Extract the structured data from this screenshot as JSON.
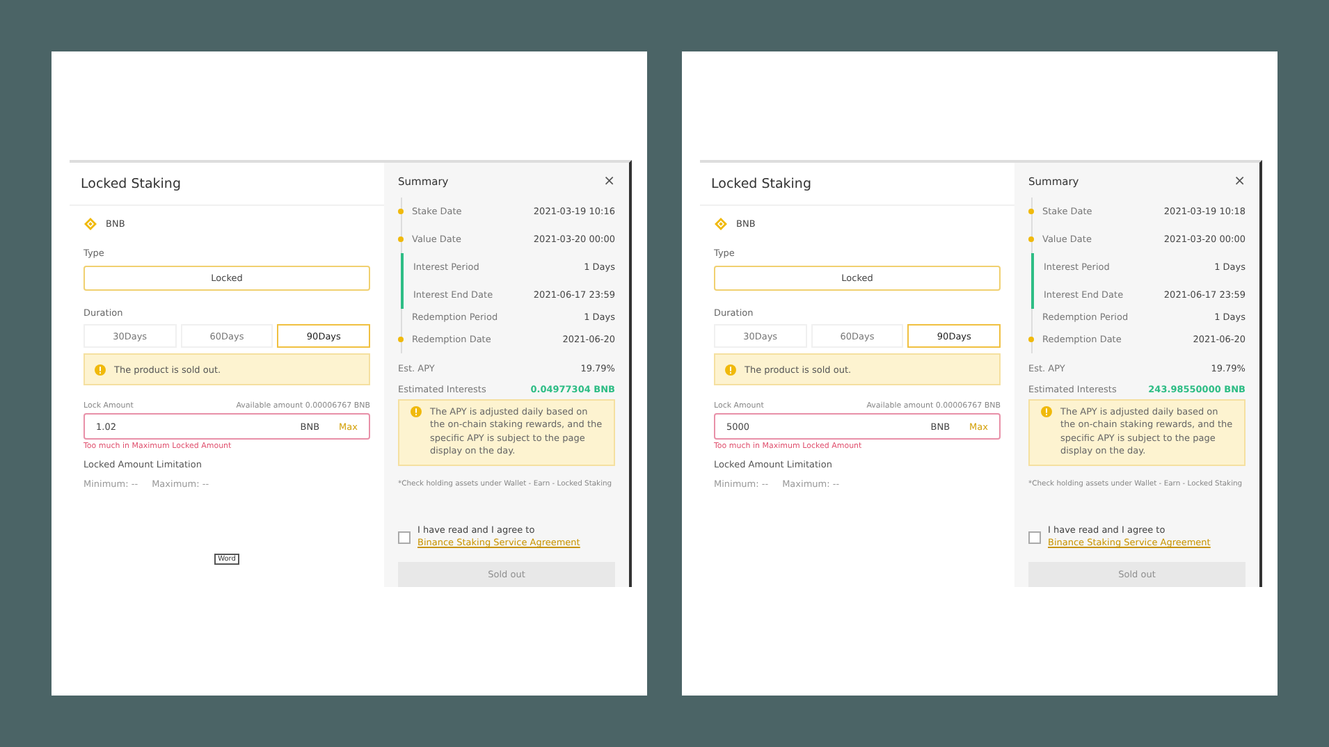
{
  "panels": [
    {
      "modal": {
        "title": "Locked Staking",
        "coin": "BNB",
        "type_label": "Type",
        "type_value": "Locked",
        "duration_label": "Duration",
        "durations": [
          {
            "label": "30Days",
            "selected": false
          },
          {
            "label": "60Days",
            "selected": false
          },
          {
            "label": "90Days",
            "selected": true
          }
        ],
        "alert": "The product is sold out.",
        "amount_label": "Lock Amount",
        "available": "Available amount 0.00006767 BNB",
        "amount_value": "1.02",
        "unit": "BNB",
        "max": "Max",
        "error": "Too much in Maximum Locked Amount",
        "limitation_title": "Locked Amount Limitation",
        "minimum": "Minimum: --",
        "maximum": "Maximum: --",
        "tooltip": "Word"
      },
      "summary": {
        "title": "Summary",
        "close": "×",
        "timeline": [
          {
            "label": "Stake Date",
            "value": "2021-03-19 10:16",
            "dot": true,
            "highlighted": false
          },
          {
            "label": "Value Date",
            "value": "2021-03-20 00:00",
            "dot": true,
            "highlighted": false
          },
          {
            "label": "Interest Period",
            "value": "1 Days",
            "dot": false,
            "highlighted": true
          },
          {
            "label": "Interest End Date",
            "value": "2021-06-17 23:59",
            "dot": false,
            "highlighted": true
          },
          {
            "label": "Redemption Period",
            "value": "1 Days",
            "dot": false,
            "highlighted": false
          },
          {
            "label": "Redemption Date",
            "value": "2021-06-20",
            "dot": true,
            "highlighted": false
          }
        ],
        "apy_label": "Est. APY",
        "apy": "19.79%",
        "interest_label": "Estimated Interests",
        "interest": "0.04977304 BNB",
        "note": "The APY is adjusted daily based on the on-chain staking rewards, and the specific APY is subject to the page display on the day.",
        "footnote": "*Check holding assets under Wallet - Earn - Locked Staking",
        "agree": "I have read and I agree to",
        "agree_link": "Binance Staking Service Agreement",
        "checked": false,
        "button": "Sold out",
        "button_disabled": true
      }
    },
    {
      "modal": {
        "title": "Locked Staking",
        "coin": "BNB",
        "type_label": "Type",
        "type_value": "Locked",
        "duration_label": "Duration",
        "durations": [
          {
            "label": "30Days",
            "selected": false
          },
          {
            "label": "60Days",
            "selected": false
          },
          {
            "label": "90Days",
            "selected": true
          }
        ],
        "alert": "The product is sold out.",
        "amount_label": "Lock Amount",
        "available": "Available amount 0.00006767 BNB",
        "amount_value": "5000",
        "unit": "BNB",
        "max": "Max",
        "error": "Too much in Maximum Locked Amount",
        "limitation_title": "Locked Amount Limitation",
        "minimum": "Minimum: --",
        "maximum": "Maximum: --"
      },
      "summary": {
        "title": "Summary",
        "close": "×",
        "timeline": [
          {
            "label": "Stake Date",
            "value": "2021-03-19 10:18",
            "dot": true,
            "highlighted": false
          },
          {
            "label": "Value Date",
            "value": "2021-03-20 00:00",
            "dot": true,
            "highlighted": false
          },
          {
            "label": "Interest Period",
            "value": "1 Days",
            "dot": false,
            "highlighted": true
          },
          {
            "label": "Interest End Date",
            "value": "2021-06-17 23:59",
            "dot": false,
            "highlighted": true
          },
          {
            "label": "Redemption Period",
            "value": "1 Days",
            "dot": false,
            "highlighted": false
          },
          {
            "label": "Redemption Date",
            "value": "2021-06-20",
            "dot": true,
            "highlighted": false
          }
        ],
        "apy_label": "Est. APY",
        "apy": "19.79%",
        "interest_label": "Estimated Interests",
        "interest": "243.98550000 BNB",
        "note": "The APY is adjusted daily based on the on-chain staking rewards, and the specific APY is subject to the page display on the day.",
        "footnote": "*Check holding assets under Wallet - Earn - Locked Staking",
        "agree": "I have read and I agree to",
        "agree_link": "Binance Staking Service Agreement",
        "checked": false,
        "button": "Sold out",
        "button_disabled": true
      }
    }
  ]
}
